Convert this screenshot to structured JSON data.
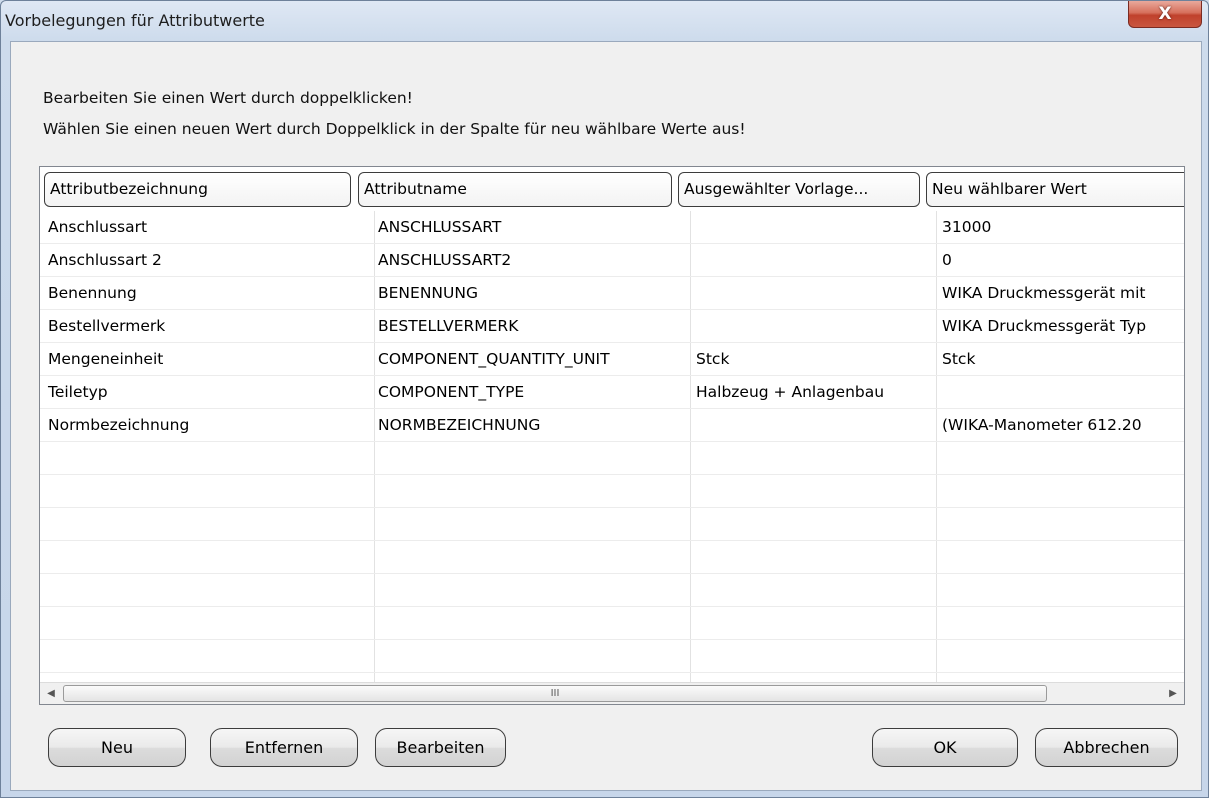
{
  "window": {
    "title": "Vorbelegungen für Attributwerte",
    "close_glyph": "X"
  },
  "instructions": {
    "line1": "Bearbeiten Sie einen Wert durch doppelklicken!",
    "line2": "Wählen Sie einen neuen Wert durch Doppelklick in der Spalte für neu wählbare Werte aus!"
  },
  "table": {
    "columns": [
      "Attributbezeichnung",
      "Attributname",
      "Ausgewählter Vorlage...",
      "Neu wählbarer Wert"
    ],
    "rows": [
      [
        "Anschlussart",
        "ANSCHLUSSART",
        "",
        "31000"
      ],
      [
        "Anschlussart 2",
        "ANSCHLUSSART2",
        "",
        "0"
      ],
      [
        "Benennung",
        "BENENNUNG",
        "",
        "WIKA Druckmessgerät mit"
      ],
      [
        "Bestellvermerk",
        "BESTELLVERMERK",
        "",
        "WIKA Druckmessgerät Typ"
      ],
      [
        "Mengeneinheit",
        "COMPONENT_QUANTITY_UNIT",
        "Stck",
        "Stck"
      ],
      [
        "Teiletyp",
        "COMPONENT_TYPE",
        "Halbzeug + Anlagenbau",
        ""
      ],
      [
        "Normbezeichnung",
        "NORMBEZEICHNUNG",
        "",
        "(WIKA-Manometer 612.20"
      ]
    ]
  },
  "scrollbar": {
    "left_arrow": "◀",
    "right_arrow": "▶",
    "grip": "III"
  },
  "buttons": {
    "new": "Neu",
    "remove": "Entfernen",
    "edit": "Bearbeiten",
    "ok": "OK",
    "cancel": "Abbrechen"
  }
}
